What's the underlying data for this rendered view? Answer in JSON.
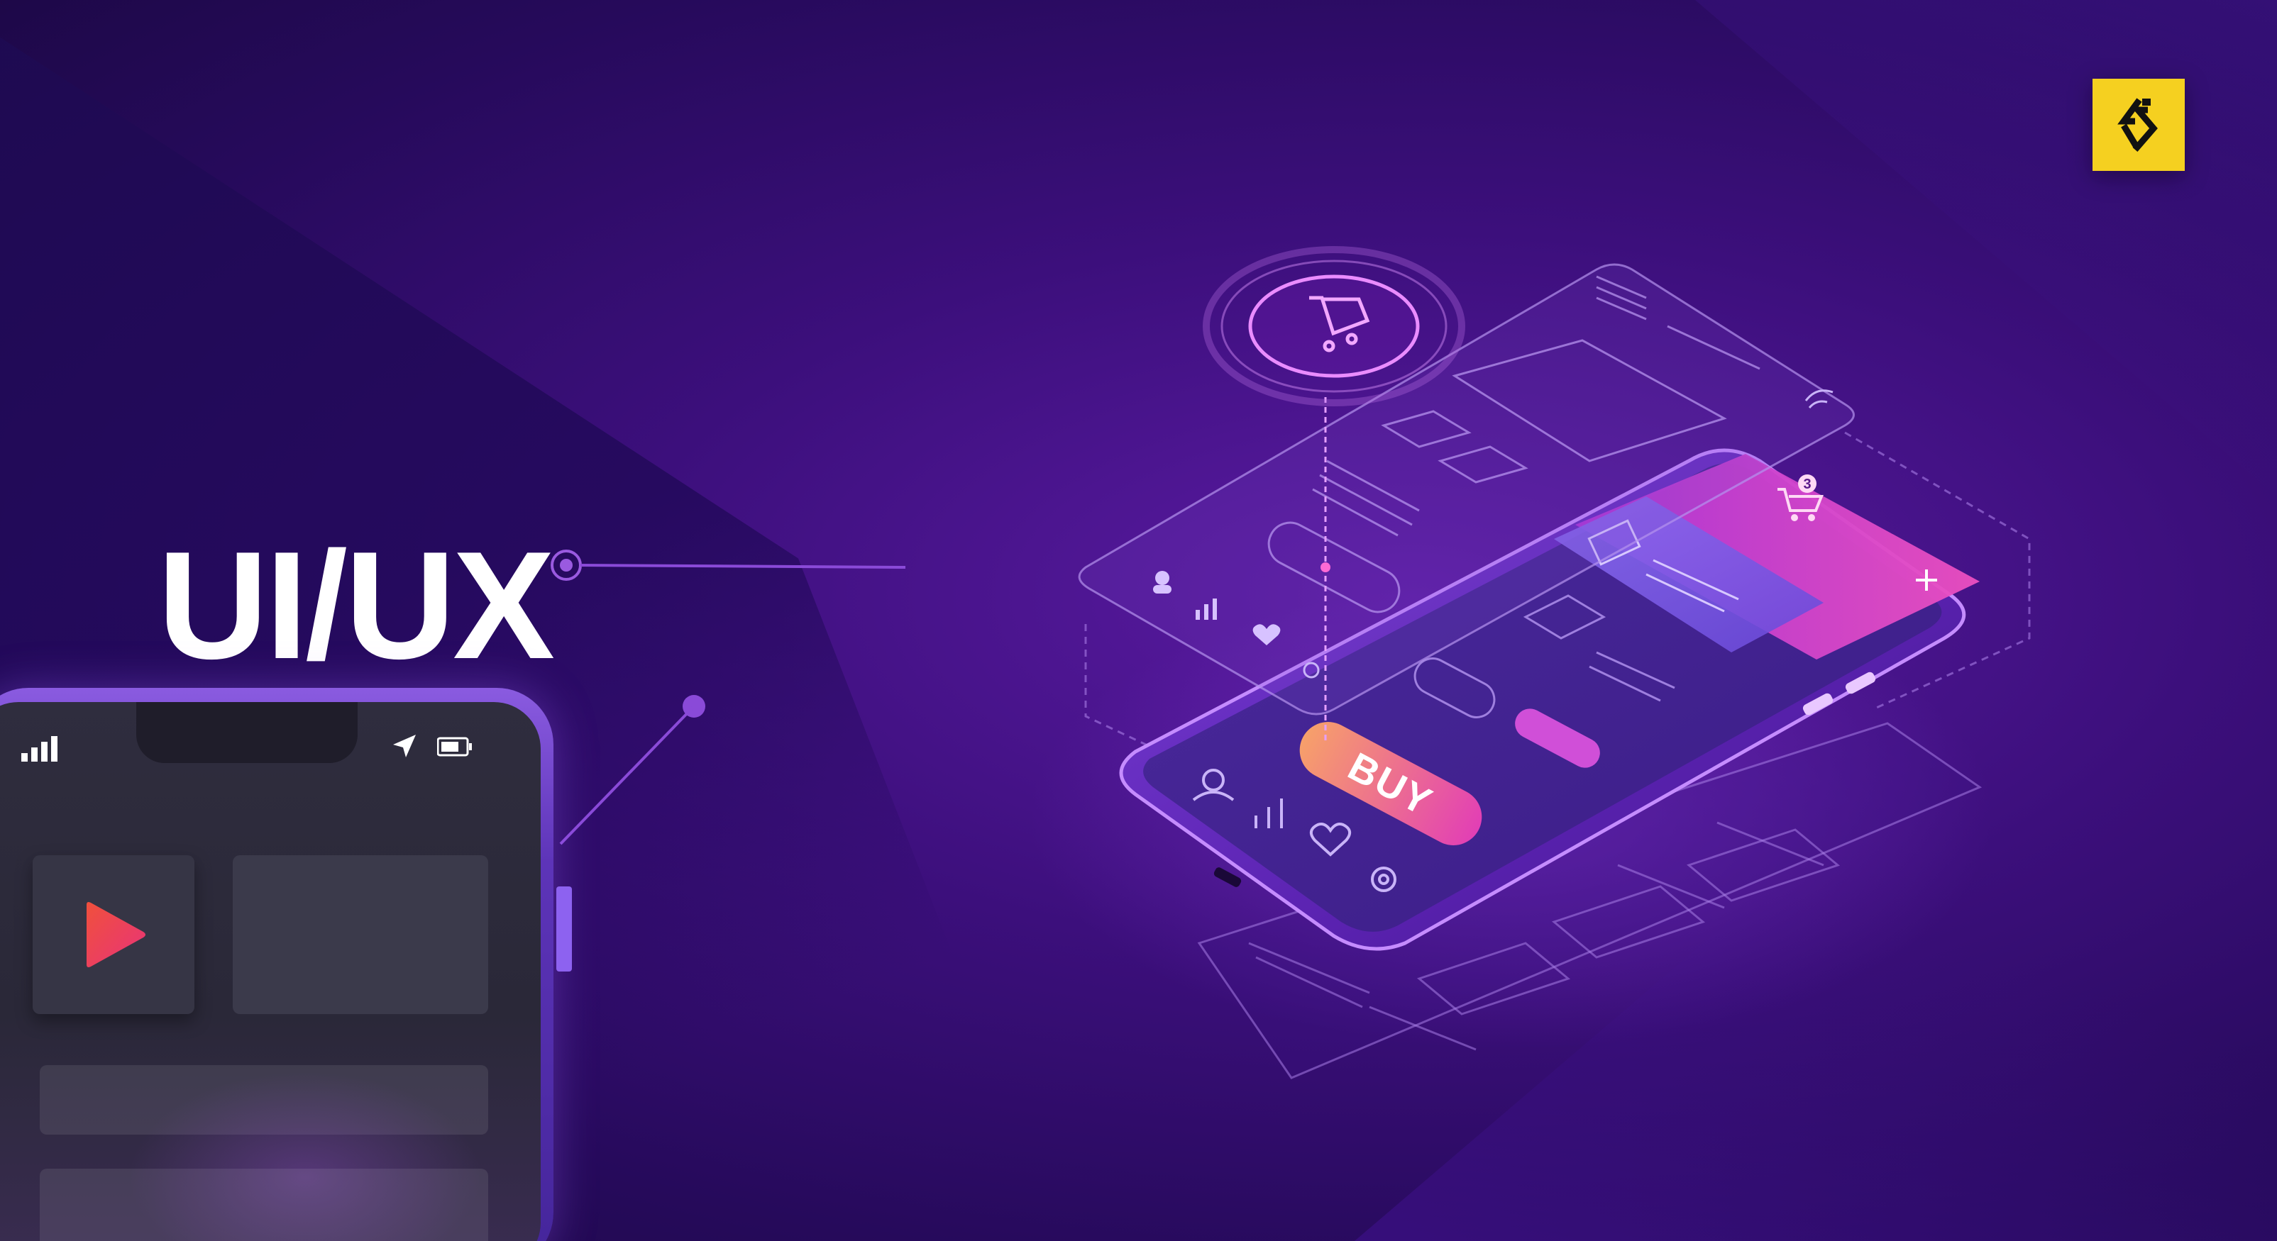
{
  "headline": {
    "text": "UI/UX"
  },
  "mockup": {
    "buy_button_label": "BUY",
    "cart_badge_count": "3"
  },
  "icons": {
    "logo": "brand-logo-icon",
    "signal": "signal-bars-icon",
    "location": "location-arrow-icon",
    "battery": "battery-icon",
    "play": "play-icon",
    "cart": "shopping-cart-icon",
    "user": "user-icon",
    "chart": "bar-chart-icon",
    "heart": "heart-icon",
    "settings": "gear-icon",
    "plus": "plus-icon",
    "wifi": "wifi-icon"
  },
  "colors": {
    "background": "#2a0c5e",
    "accent_yellow": "#f5d020",
    "accent_pink": "#e23fb5",
    "play_gradient_start": "#f0503c",
    "play_gradient_end": "#e8337a",
    "text": "#ffffff"
  }
}
